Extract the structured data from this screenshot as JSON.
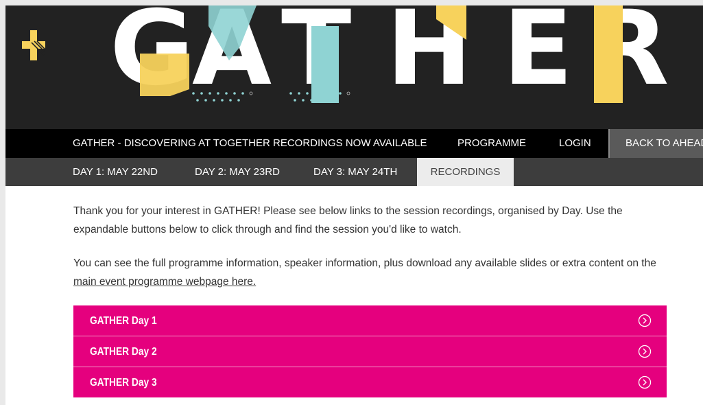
{
  "hero": {
    "logo_letters": [
      "G",
      "A",
      "T",
      "H",
      "E",
      "R"
    ],
    "colors": {
      "background": "#222222",
      "yellow": "#f7d25c",
      "teal": "#8fd3d3",
      "white": "#ffffff"
    },
    "icons": [
      "plus-logo-icon",
      "dot-pattern-icon"
    ]
  },
  "nav_primary": {
    "items": [
      {
        "label": "GATHER - DISCOVERING AT TOGETHER RECORDINGS NOW AVAILABLE"
      },
      {
        "label": "PROGRAMME"
      },
      {
        "label": "LOGIN"
      }
    ],
    "back_label": "BACK TO AHEAD"
  },
  "nav_secondary": {
    "items": [
      {
        "label": "DAY 1: MAY 22ND"
      },
      {
        "label": "DAY 2: MAY 23RD"
      },
      {
        "label": "DAY 3: MAY 24TH"
      }
    ],
    "active_label": "RECORDINGS"
  },
  "content": {
    "intro": "Thank you for your interest in GATHER! Please see below links to the session recordings, organised by Day. Use the expandable buttons below to click through and find the session you'd like to watch.",
    "programme_text": "You can see the full programme information, speaker information, plus download any available slides or extra content on the ",
    "programme_link": "main event programme webpage here."
  },
  "accordion": {
    "accent_color": "#e5007e",
    "items": [
      {
        "label": "GATHER Day 1",
        "icon": "chevron-right-circle-icon"
      },
      {
        "label": "GATHER Day 2",
        "icon": "chevron-right-circle-icon"
      },
      {
        "label": "GATHER Day 3",
        "icon": "chevron-right-circle-icon"
      }
    ]
  }
}
